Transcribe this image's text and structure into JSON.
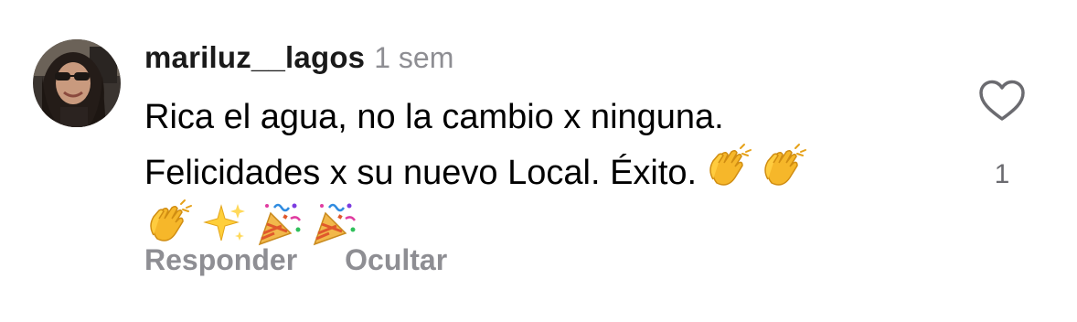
{
  "comment": {
    "username": "mariluz__lagos",
    "timestamp": "1 sem",
    "text_lines": [
      "Rica el agua, no la cambio x ninguna.",
      "Felicidades x su nuevo Local. Éxito."
    ],
    "emojis_line2": [
      "👏",
      "👏"
    ],
    "emojis_line3": [
      "👏",
      "✨",
      "🎉",
      "🎉"
    ],
    "actions": {
      "reply": "Responder",
      "hide": "Ocultar"
    },
    "likes": {
      "count": "1",
      "icon": "heart-outline-icon"
    }
  },
  "colors": {
    "text": "#000000",
    "username": "#1a1a1a",
    "secondary": "#8e8e93",
    "background": "#ffffff"
  }
}
